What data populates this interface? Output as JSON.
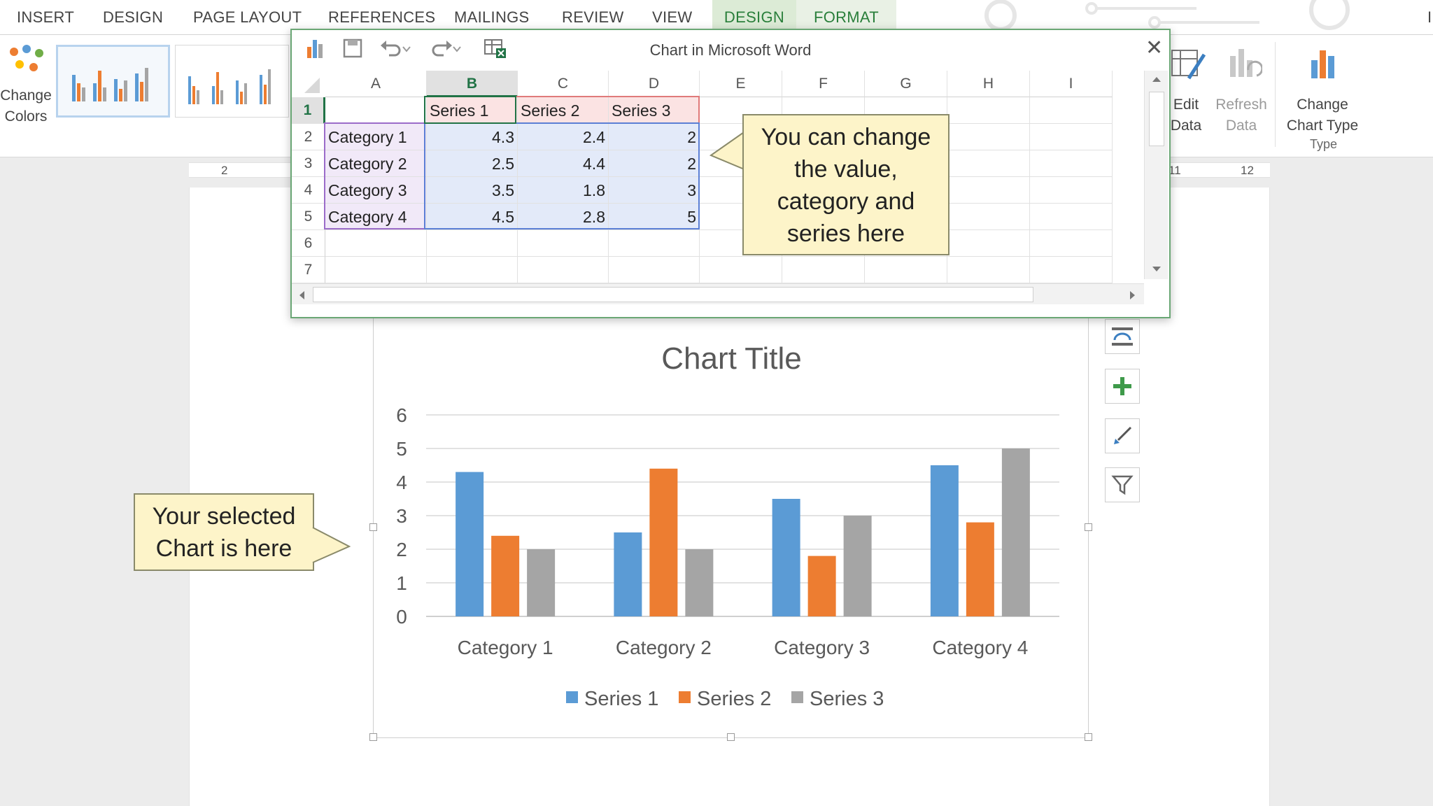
{
  "tabs": [
    "INSERT",
    "DESIGN",
    "PAGE LAYOUT",
    "REFERENCES",
    "MAILINGS",
    "REVIEW",
    "VIEW",
    "DESIGN",
    "FORMAT"
  ],
  "ribbon": {
    "change_colors": "Change Colors",
    "edit_data": "Edit Data",
    "refresh_data": "Refresh Data",
    "change_chart_type": "Change Chart Type",
    "group_type": "Type"
  },
  "ruler": {
    "left_num": "2",
    "right_num1": "11",
    "right_num2": "12"
  },
  "sheet": {
    "title": "Chart in Microsoft Word",
    "close": "✕",
    "columns": [
      "A",
      "B",
      "C",
      "D",
      "E",
      "F",
      "G",
      "H",
      "I"
    ],
    "rows": [
      "1",
      "2",
      "3",
      "4",
      "5",
      "6",
      "7"
    ],
    "headers": [
      "",
      "Series 1",
      "Series 2",
      "Series 3"
    ],
    "data": [
      [
        "Category 1",
        "4.3",
        "2.4",
        "2"
      ],
      [
        "Category 2",
        "2.5",
        "4.4",
        "2"
      ],
      [
        "Category 3",
        "3.5",
        "1.8",
        "3"
      ],
      [
        "Category 4",
        "4.5",
        "2.8",
        "5"
      ]
    ]
  },
  "callouts": {
    "right": [
      "You can change",
      "the value,",
      "category and",
      "series here"
    ],
    "left": [
      "Your selected",
      "Chart is here"
    ]
  },
  "colors": {
    "series1": "#5b9bd5",
    "series2": "#ed7d31",
    "series3": "#a5a5a5",
    "ribbon_accent": "#217346"
  },
  "chart_data": {
    "type": "bar",
    "title": "Chart Title",
    "categories": [
      "Category 1",
      "Category 2",
      "Category 3",
      "Category 4"
    ],
    "series": [
      {
        "name": "Series 1",
        "values": [
          4.3,
          2.5,
          3.5,
          4.5
        ]
      },
      {
        "name": "Series 2",
        "values": [
          2.4,
          4.4,
          1.8,
          2.8
        ]
      },
      {
        "name": "Series 3",
        "values": [
          2,
          2,
          3,
          5
        ]
      }
    ],
    "ylim": [
      0,
      6
    ],
    "yticks": [
      "0",
      "1",
      "2",
      "3",
      "4",
      "5",
      "6"
    ],
    "grid": true,
    "legend": "bottom"
  },
  "chart_buttons": [
    "layout-options-icon",
    "plus-icon",
    "brush-icon",
    "filter-icon"
  ]
}
